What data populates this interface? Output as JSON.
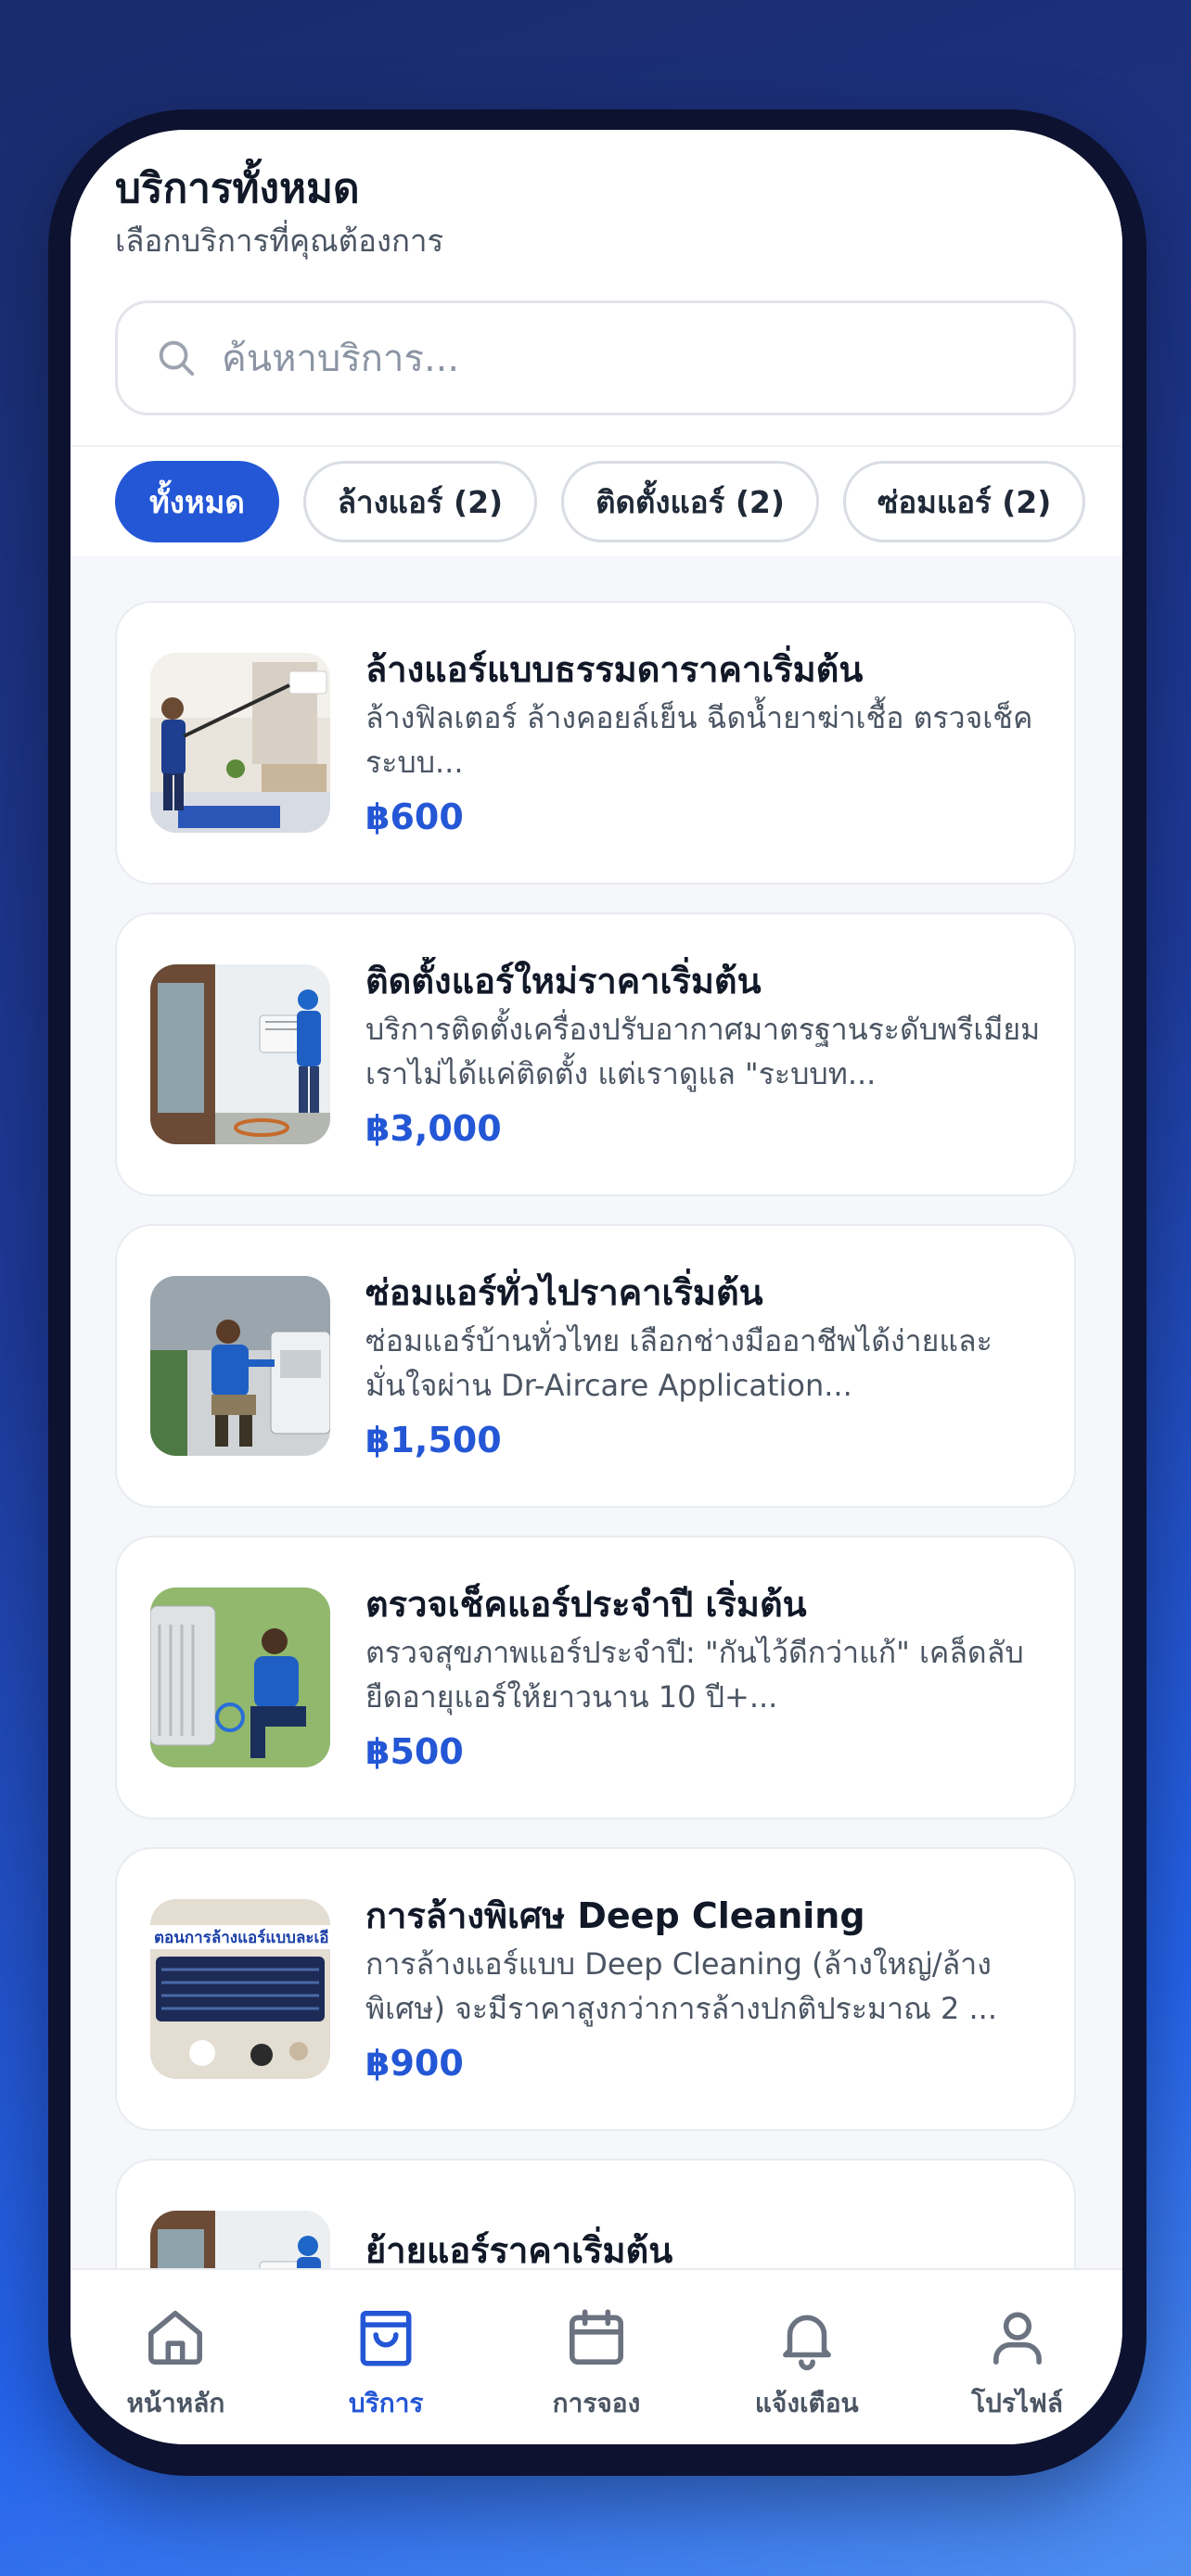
{
  "header": {
    "title": "บริการทั้งหมด",
    "subtitle": "เลือกบริการที่คุณต้องการ"
  },
  "search": {
    "placeholder": "ค้นหาบริการ..."
  },
  "filters": [
    {
      "label": "ทั้งหมด",
      "active": true
    },
    {
      "label": "ล้างแอร์ (2)",
      "active": false
    },
    {
      "label": "ติดตั้งแอร์ (2)",
      "active": false
    },
    {
      "label": "ซ่อมแอร์ (2)",
      "active": false
    }
  ],
  "services": [
    {
      "title": "ล้างแอร์แบบธรรมดาราคาเริ่มต้น",
      "desc": "ล้างฟิลเตอร์ ล้างคอยล์เย็น ฉีดน้ำยาฆ่าเชื้อ ตรวจเช็คระบบ...",
      "price": "฿600",
      "image": "technician-washing-ac-photo"
    },
    {
      "title": "ติดตั้งแอร์ใหม่ราคาเริ่มต้น",
      "desc": "บริการติดตั้งเครื่องปรับอากาศมาตรฐานระดับพรีเมียม เราไม่ได้แค่ติดตั้ง แต่เราดูแล \"ระบบท...",
      "price": "฿3,000",
      "image": "technician-installing-ac-photo"
    },
    {
      "title": "ซ่อมแอร์ทั่วไปราคาเริ่มต้น",
      "desc": "ซ่อมแอร์บ้านทั่วไทย เลือกช่างมืออาชีพได้ง่ายและมั่นใจผ่าน Dr-Aircare Application...",
      "price": "฿1,500",
      "image": "technician-repairing-ac-photo"
    },
    {
      "title": "ตรวจเช็คแอร์ประจำปี เริ่มต้น",
      "desc": "ตรวจสุขภาพแอร์ประจำปี: \"กันไว้ดีกว่าแก้\" เคล็ดลับยืดอายุแอร์ให้ยาวนาน 10 ปี+...",
      "price": "฿500",
      "image": "technician-checking-ac-photo"
    },
    {
      "title": "การล้างพิเศษ Deep Cleaning",
      "desc": "การล้างแอร์แบบ Deep Cleaning (ล้างใหญ่/ล้างพิเศษ) จะมีราคาสูงกว่าการล้างปกติประมาณ 2 ...",
      "price": "฿900",
      "image": "deep-cleaning-ac-parts-photo",
      "image_caption": "ตอนการล้างแอร์แบบละเอี"
    },
    {
      "title": "ย้ายแอร์ราคาเริ่มต้น",
      "desc": "",
      "price": "",
      "image": "technician-installing-ac-photo"
    }
  ],
  "nav": [
    {
      "label": "หน้าหลัก",
      "icon": "home-icon",
      "active": false
    },
    {
      "label": "บริการ",
      "icon": "shopping-bag-icon",
      "active": true
    },
    {
      "label": "การจอง",
      "icon": "calendar-icon",
      "active": false
    },
    {
      "label": "แจ้งเตือน",
      "icon": "bell-icon",
      "active": false
    },
    {
      "label": "โปรไฟล์",
      "icon": "user-icon",
      "active": false
    }
  ],
  "colors": {
    "accent": "#2457d6",
    "background_top": "#1a2b6b",
    "background_bottom": "#4f8ef0"
  }
}
